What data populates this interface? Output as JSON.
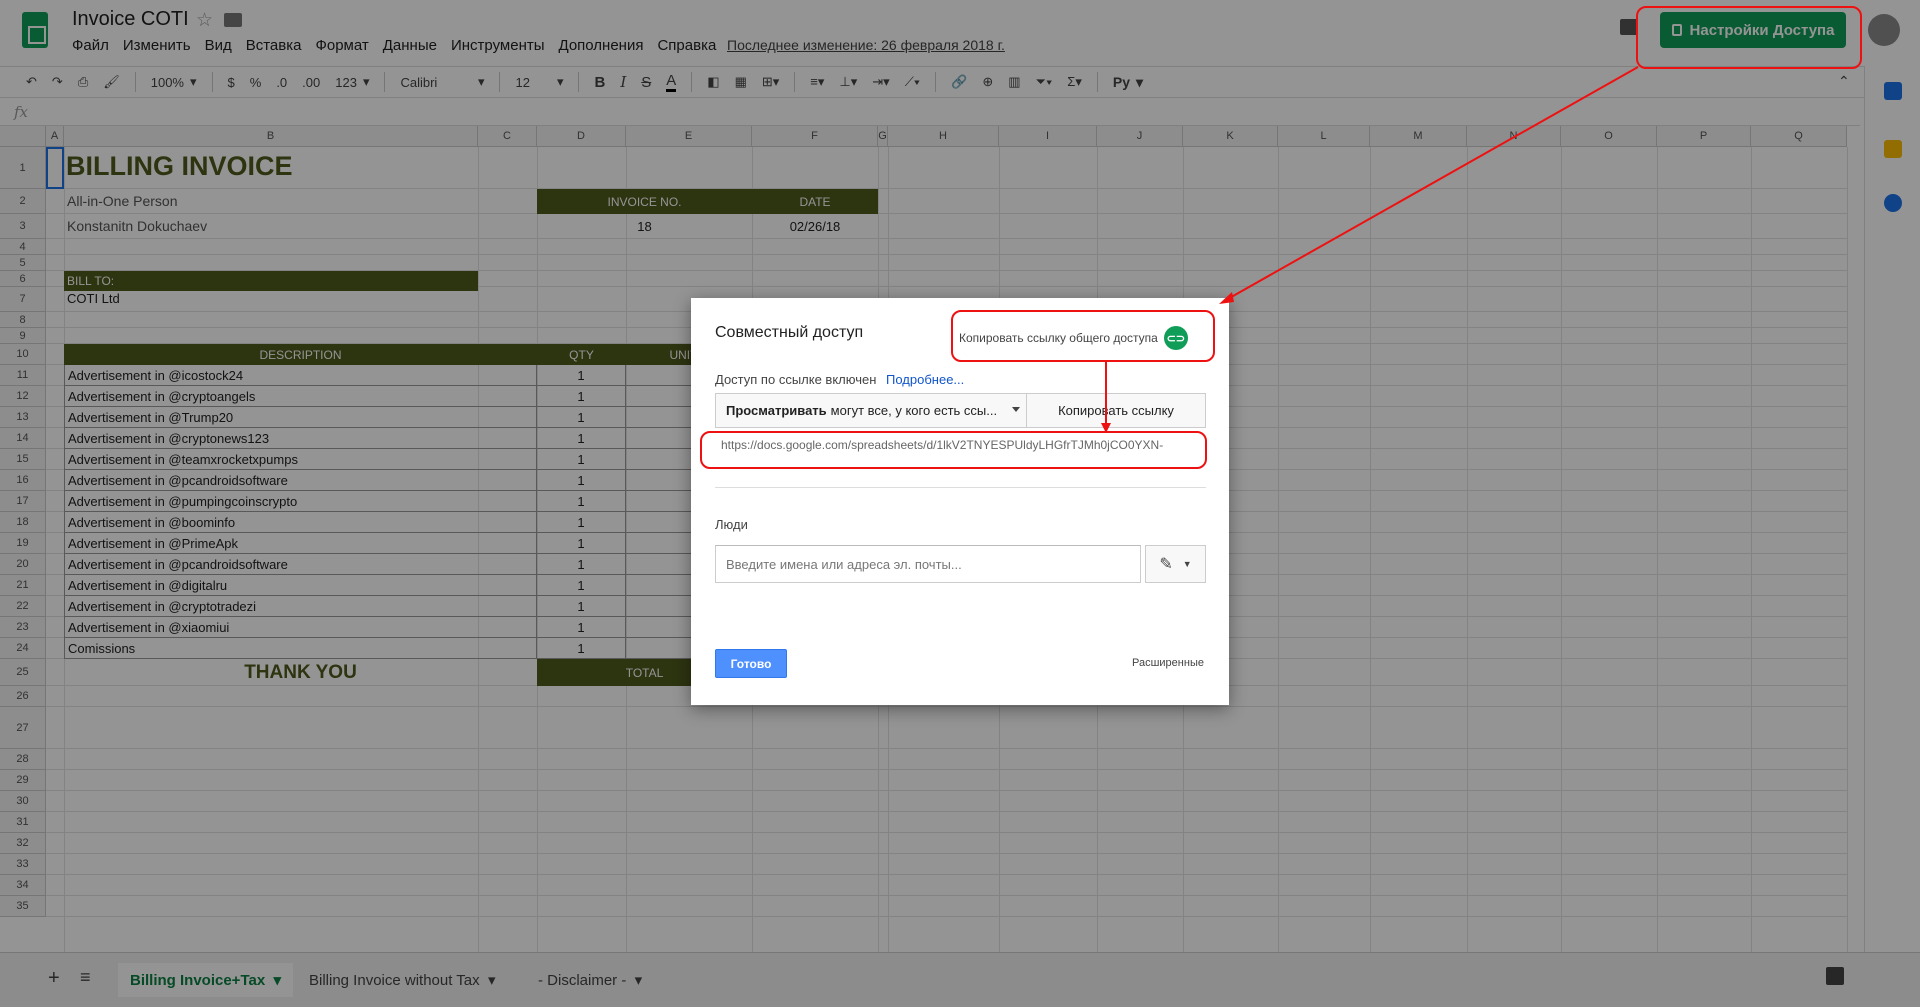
{
  "header": {
    "title": "Invoice COTI",
    "menu": [
      "Файл",
      "Изменить",
      "Вид",
      "Вставка",
      "Формат",
      "Данные",
      "Инструменты",
      "Дополнения",
      "Справка"
    ],
    "last_edit": "Последнее изменение: 26 февраля 2018 г.",
    "share_label": "Настройки Доступа"
  },
  "toolbar": {
    "zoom": "100%",
    "currency": "$",
    "percent": "%",
    "dec_less": ".0",
    "dec_more": ".00",
    "format": "123",
    "font": "Calibri",
    "font_size": "12",
    "bold": "B",
    "italic": "I",
    "strike": "S",
    "text_color": "A",
    "lang": "Ру"
  },
  "formula_bar": {
    "fx": "fx"
  },
  "columns": [
    "A",
    "B",
    "C",
    "D",
    "E",
    "F",
    "G",
    "H",
    "I",
    "J",
    "K",
    "L",
    "M",
    "N",
    "O",
    "P",
    "Q"
  ],
  "rows": [
    "1",
    "2",
    "3",
    "4",
    "5",
    "6",
    "7",
    "8",
    "9",
    "10",
    "11",
    "12",
    "13",
    "14",
    "15",
    "16",
    "17",
    "18",
    "19",
    "20",
    "21",
    "22",
    "23",
    "24",
    "25",
    "26",
    "27",
    "28",
    "29",
    "30",
    "31",
    "32",
    "33",
    "34",
    "35"
  ],
  "sheet": {
    "title": "BILLING INVOICE",
    "line1": "All-in-One Person",
    "line2": "Konstanitn Dokuchaev",
    "invoice_no_header": "INVOICE NO.",
    "date_header": "DATE",
    "invoice_no": "18",
    "date": "02/26/18",
    "bill_to_header": "BILL TO:",
    "bill_to": "COTI Ltd",
    "desc_header": "DESCRIPTION",
    "qty_header": "QTY",
    "unit_header": "UNIT P",
    "items": [
      {
        "desc": "Advertisement in @icostock24",
        "qty": "1"
      },
      {
        "desc": "Advertisement in @cryptoangels",
        "qty": "1"
      },
      {
        "desc": "Advertisement in @Trump20",
        "qty": "1"
      },
      {
        "desc": "Advertisement in @cryptonews123",
        "qty": "1"
      },
      {
        "desc": "Advertisement in @teamxrocketxpumps",
        "qty": "1"
      },
      {
        "desc": "Advertisement in @pcandroidsoftware",
        "qty": "1"
      },
      {
        "desc": "Advertisement in @pumpingcoinscrypto",
        "qty": "1"
      },
      {
        "desc": "Advertisement in @boominfo",
        "qty": "1"
      },
      {
        "desc": "Advertisement in @PrimeApk",
        "qty": "1"
      },
      {
        "desc": "Advertisement in @pcandroidsoftware",
        "qty": "1"
      },
      {
        "desc": "Advertisement in @digitalru",
        "qty": "1"
      },
      {
        "desc": "Advertisement in @cryptotradezi",
        "qty": "1"
      },
      {
        "desc": "Advertisement in @xiaomiui",
        "qty": "1"
      },
      {
        "desc": "Comissions",
        "qty": "1"
      }
    ],
    "thank_you": "THANK YOU",
    "total_label": "TOTAL"
  },
  "tabs": [
    "Billing Invoice+Tax",
    "Billing Invoice without Tax",
    "- Disclaimer -"
  ],
  "dialog": {
    "title": "Совместный доступ",
    "copy_public_link": "Копировать ссылку общего доступа",
    "link_status": "Доступ по ссылке включен",
    "more": "Подробнее...",
    "perm_bold": "Просматривать",
    "perm_rest": "могут все, у кого есть ссы...",
    "copy_link": "Копировать ссылку",
    "url": "https://docs.google.com/spreadsheets/d/1lkV2TNYESPUldyLHGfrTJMh0jCO0YXN-",
    "people_label": "Люди",
    "people_placeholder": "Введите имена или адреса эл. почты...",
    "done": "Готово",
    "advanced": "Расширенные"
  },
  "colors": {
    "brand_green": "#0f9d58",
    "header_olive": "#4f5a1c",
    "callout_red": "#e11111",
    "done_blue": "#4d90fe"
  }
}
